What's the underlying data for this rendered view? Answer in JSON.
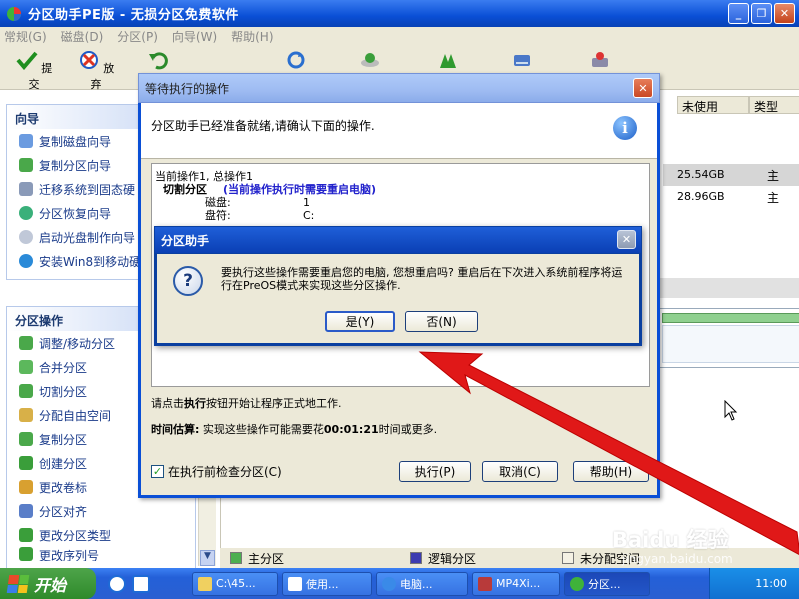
{
  "app": {
    "title": "分区助手PE版 - 无损分区免费软件",
    "window_buttons": [
      "_",
      "❐",
      "✕"
    ]
  },
  "menu": [
    "常规(G)",
    "磁盘(D)",
    "分区(P)",
    "向导(W)",
    "帮助(H)"
  ],
  "toolbar": {
    "commit_label": "提交",
    "discard_label": "放弃"
  },
  "wizard_panel": {
    "title": "向导",
    "items": [
      {
        "label": "复制磁盘向导",
        "icon": "copy-disk-icon"
      },
      {
        "label": "复制分区向导",
        "icon": "copy-partition-icon"
      },
      {
        "label": "迁移系统到固态硬",
        "icon": "migrate-os-icon"
      },
      {
        "label": "分区恢复向导",
        "icon": "partition-recovery-icon"
      },
      {
        "label": "启动光盘制作向导",
        "icon": "boot-cd-icon"
      },
      {
        "label": "安装Win8到移动硬",
        "icon": "install-win8-icon"
      }
    ]
  },
  "partition_panel": {
    "title": "分区操作",
    "items": [
      {
        "label": "调整/移动分区",
        "icon": "resize-partition-icon"
      },
      {
        "label": "合并分区",
        "icon": "merge-partition-icon"
      },
      {
        "label": "切割分区",
        "icon": "split-partition-icon"
      },
      {
        "label": "分配自由空间",
        "icon": "allocate-space-icon"
      },
      {
        "label": "复制分区",
        "icon": "copy-partition-icon"
      },
      {
        "label": "创建分区",
        "icon": "create-partition-icon"
      },
      {
        "label": "更改卷标",
        "icon": "change-label-icon"
      },
      {
        "label": "分区对齐",
        "icon": "align-partition-icon"
      },
      {
        "label": "更改分区类型",
        "icon": "change-type-icon"
      },
      {
        "label": "更改序列号",
        "icon": "change-serial-icon"
      }
    ]
  },
  "grid": {
    "headers": [
      "未使用",
      "类型"
    ],
    "rows": [
      {
        "unused": "25.54GB",
        "type": "主"
      },
      {
        "unused": "28.96GB",
        "type": "主"
      }
    ]
  },
  "legend": [
    "主分区",
    "逻辑分区",
    "未分配空间"
  ],
  "colors": {
    "primary": "#4caf50",
    "logical": "#3c3cb0",
    "unallocated": "#f4f1e4",
    "arrow": "#e01818"
  },
  "pending_dialog": {
    "title": "等待执行的操作",
    "header": "分区助手已经准备就绪,请确认下面的操作.",
    "ops_line": "当前操作1, 总操作1",
    "op_name": "切割分区",
    "op_note": "(当前操作执行时需要重启电脑)",
    "details": [
      {
        "key": "磁盘:",
        "value": "1"
      },
      {
        "key": "盘符:",
        "value": "C:"
      }
    ],
    "note_prefix": "请点击",
    "note_bold": "执行",
    "note_suffix": "按钮开始让程序正式地工作.",
    "estimate_label": "时间估算:",
    "estimate_prefix": "实现这些操作可能需要花",
    "estimate_time": "00:01:21",
    "estimate_suffix": "时间或更多.",
    "check_label": "在执行前检查分区(C)",
    "execute_label": "执行(P)",
    "cancel_label": "取消(C)",
    "help_label": "帮助(H)"
  },
  "confirm_dialog": {
    "title": "分区助手",
    "message": "要执行这些操作需要重启您的电脑, 您想重启吗? 重启后在下次进入系统前程序将运行在PreOS模式来实现这些分区操作.",
    "yes_label": "是(Y)",
    "no_label": "否(N)"
  },
  "taskbar": {
    "start_label": "开始",
    "tasks": [
      "C:\\45...",
      "使用...",
      "电脑...",
      "MP4Xi...",
      "分区..."
    ],
    "clock": "11:00"
  },
  "watermark": {
    "main": "Baidu 经验",
    "sub": "jingyan.baidu.com"
  }
}
